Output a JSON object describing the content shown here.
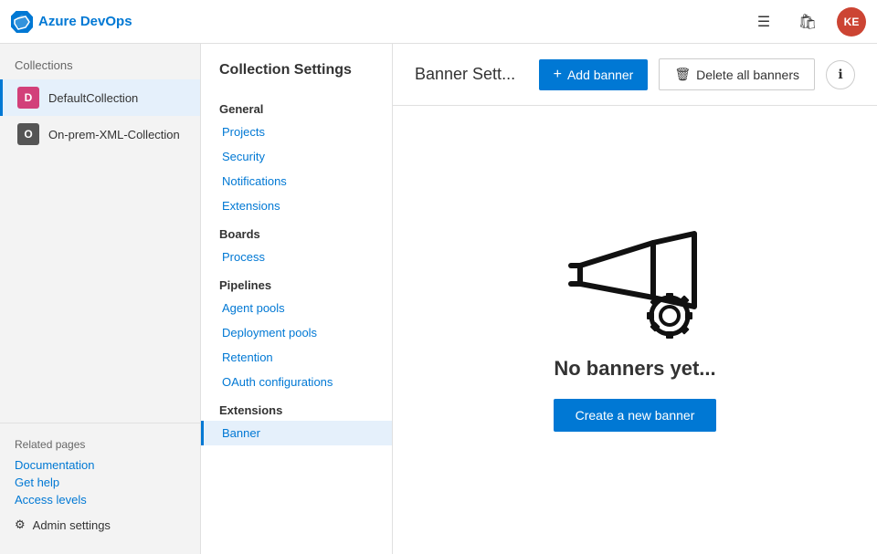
{
  "app": {
    "logo_prefix": "Azure ",
    "logo_suffix": "DevOps",
    "user_initials": "KE"
  },
  "top_nav": {
    "settings_icon": "≡",
    "bag_icon": "🛍",
    "info_tooltip": "ℹ"
  },
  "collections": {
    "section_title": "Collections",
    "items": [
      {
        "name": "DefaultCollection",
        "initial": "D",
        "color": "#d2407a",
        "active": true
      },
      {
        "name": "On-prem-XML-Collection",
        "initial": "O",
        "color": "#555",
        "active": false
      }
    ]
  },
  "sidebar_bottom": {
    "related_pages_label": "Related pages",
    "links": [
      "Documentation",
      "Get help",
      "Access levels"
    ],
    "admin_label": "Admin settings"
  },
  "settings_nav": {
    "title": "Collection Settings",
    "groups": [
      {
        "label": "General",
        "items": [
          {
            "name": "Projects",
            "active": false
          },
          {
            "name": "Security",
            "active": false
          },
          {
            "name": "Notifications",
            "active": false
          },
          {
            "name": "Extensions",
            "active": false
          }
        ]
      },
      {
        "label": "Boards",
        "items": [
          {
            "name": "Process",
            "active": false
          }
        ]
      },
      {
        "label": "Pipelines",
        "items": [
          {
            "name": "Agent pools",
            "active": false
          },
          {
            "name": "Deployment pools",
            "active": false
          },
          {
            "name": "Retention",
            "active": false
          },
          {
            "name": "OAuth configurations",
            "active": false
          }
        ]
      },
      {
        "label": "Extensions",
        "items": [
          {
            "name": "Banner",
            "active": true
          }
        ]
      }
    ]
  },
  "content": {
    "title": "Banner Sett...",
    "add_banner_label": "+ Add banner",
    "delete_banners_label": "Delete all banners",
    "empty_state_text": "No banners yet...",
    "create_banner_label": "Create a new banner"
  }
}
